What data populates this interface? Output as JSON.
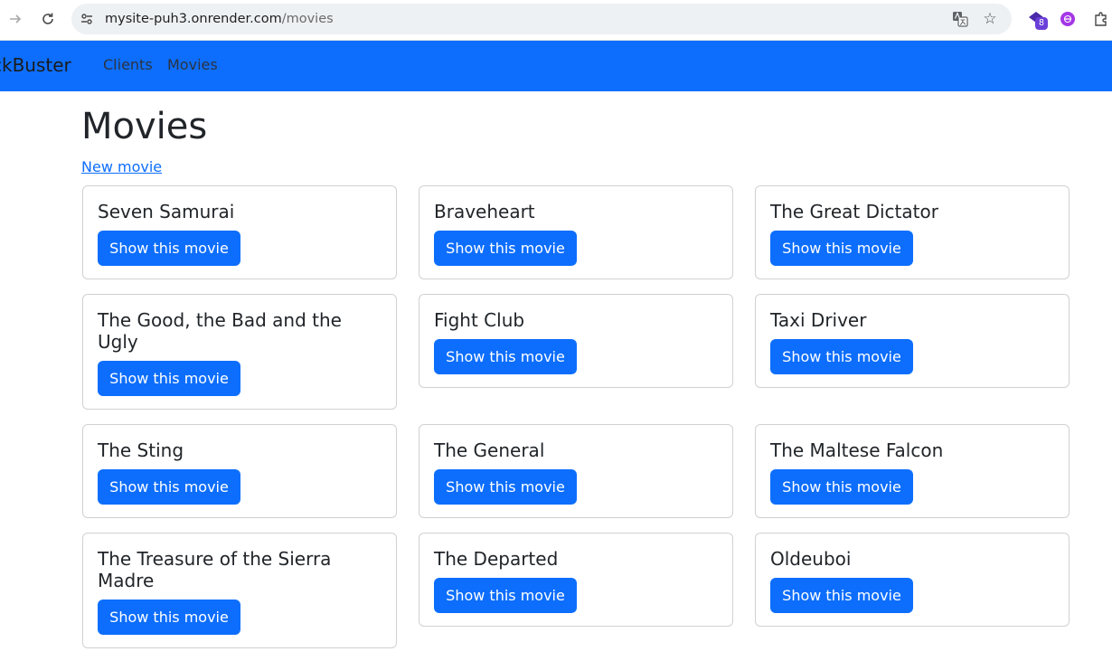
{
  "browser": {
    "url_host": "mysite-puh3.onrender.com",
    "url_path": "/movies",
    "extension_badge": "8"
  },
  "navbar": {
    "brand": "ckBuster",
    "links": [
      "Clients",
      "Movies"
    ]
  },
  "page": {
    "title": "Movies",
    "new_link": "New movie"
  },
  "movies": [
    {
      "title": "Seven Samurai",
      "button": "Show this movie"
    },
    {
      "title": "Braveheart",
      "button": "Show this movie"
    },
    {
      "title": "The Great Dictator",
      "button": "Show this movie"
    },
    {
      "title": "The Good, the Bad and the Ugly",
      "button": "Show this movie"
    },
    {
      "title": "Fight Club",
      "button": "Show this movie"
    },
    {
      "title": "Taxi Driver",
      "button": "Show this movie"
    },
    {
      "title": "The Sting",
      "button": "Show this movie"
    },
    {
      "title": "The General",
      "button": "Show this movie"
    },
    {
      "title": "The Maltese Falcon",
      "button": "Show this movie"
    },
    {
      "title": "The Treasure of the Sierra Madre",
      "button": "Show this movie"
    },
    {
      "title": "The Departed",
      "button": "Show this movie"
    },
    {
      "title": "Oldeuboi",
      "button": "Show this movie"
    }
  ],
  "colors": {
    "primary": "#0d6efd",
    "text": "#212529",
    "card_border": "#d6d6d6"
  },
  "icons": [
    "back-arrow-icon",
    "reload-icon",
    "site-info-icon",
    "translate-icon",
    "star-icon",
    "extension-icon",
    "puzzle-icon"
  ]
}
